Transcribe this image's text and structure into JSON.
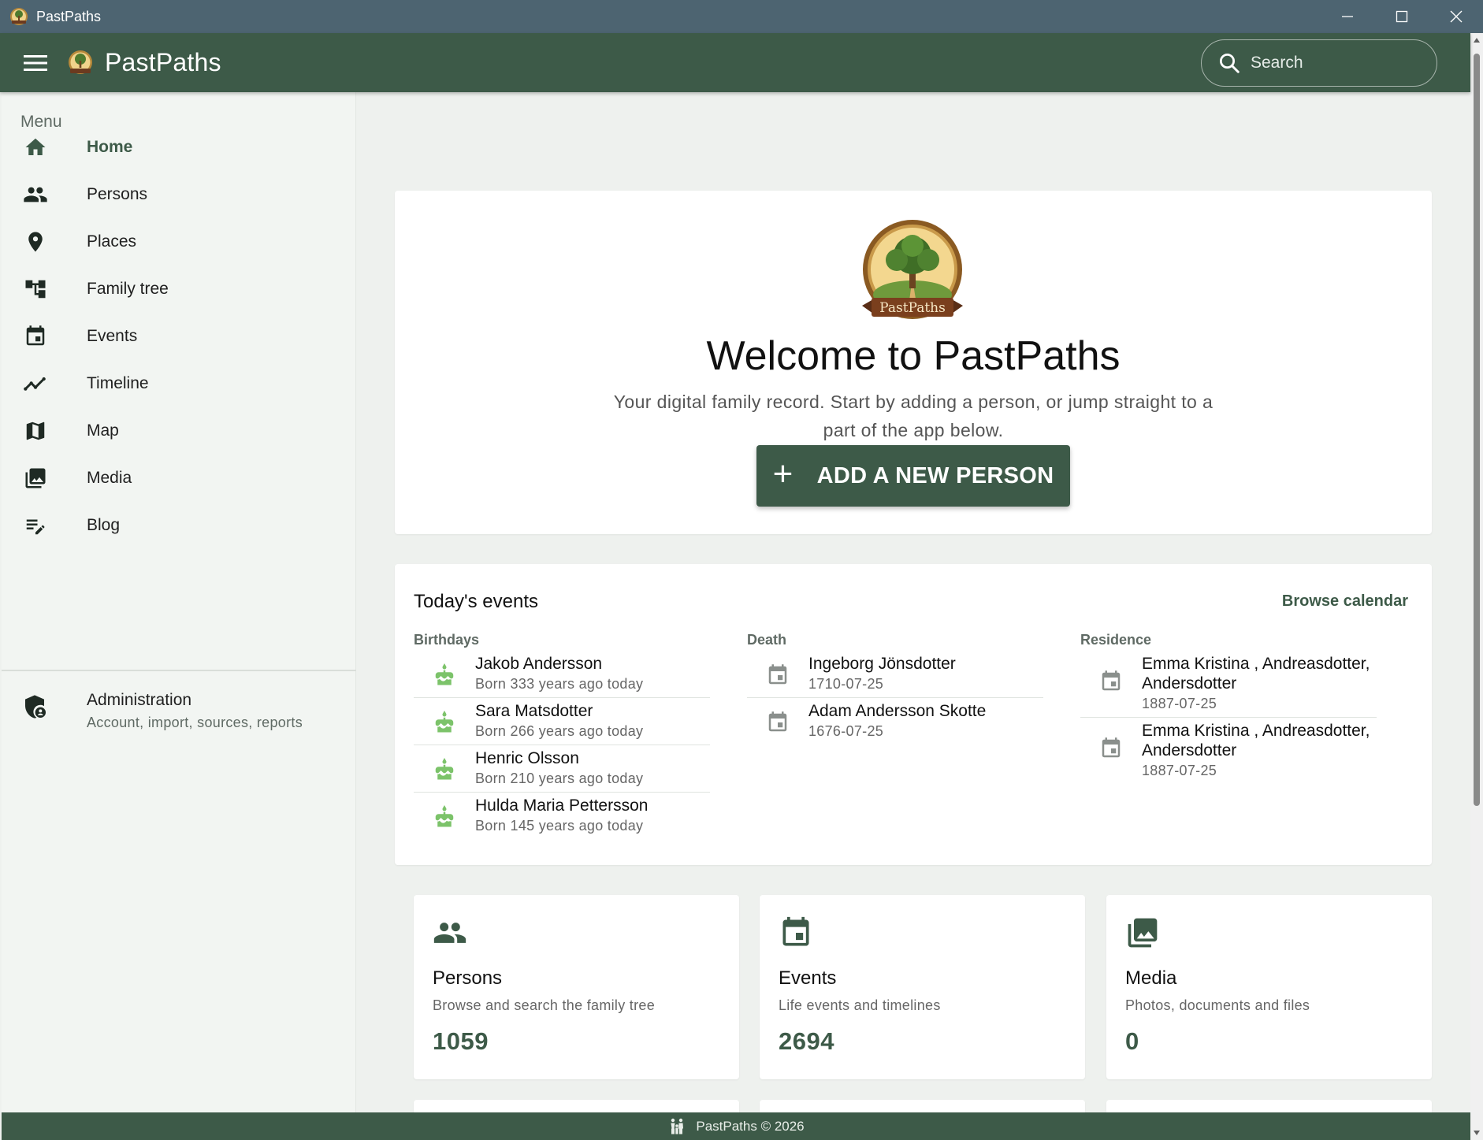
{
  "window": {
    "title": "PastPaths"
  },
  "appbar": {
    "brand": "PastPaths",
    "search_placeholder": "Search"
  },
  "sidebar": {
    "menu_label": "Menu",
    "items": [
      {
        "label": "Home",
        "icon": "home-icon"
      },
      {
        "label": "Persons",
        "icon": "people-icon"
      },
      {
        "label": "Places",
        "icon": "map-pin-icon"
      },
      {
        "label": "Family tree",
        "icon": "family-tree-icon"
      },
      {
        "label": "Events",
        "icon": "calendar-icon"
      },
      {
        "label": "Timeline",
        "icon": "timeline-icon"
      },
      {
        "label": "Map",
        "icon": "map-icon"
      },
      {
        "label": "Media",
        "icon": "photo-library-icon"
      },
      {
        "label": "Blog",
        "icon": "edit-note-icon"
      }
    ],
    "admin": {
      "title": "Administration",
      "subtitle": "Account, import, sources, reports",
      "icon": "admin-shield-icon"
    }
  },
  "welcome": {
    "logo_text": "PastPaths",
    "heading": "Welcome to PastPaths",
    "lead": "Your digital family record. Start by adding a person, or jump straight to a part of the app below.",
    "cta_label": "ADD A NEW PERSON"
  },
  "today": {
    "title": "Today's events",
    "browse_label": "Browse calendar",
    "birthdays": {
      "heading": "Birthdays",
      "items": [
        {
          "name": "Jakob Andersson",
          "sub": "Born 333 years ago today"
        },
        {
          "name": "Sara Matsdotter",
          "sub": "Born 266 years ago today"
        },
        {
          "name": "Henric Olsson",
          "sub": "Born 210 years ago today"
        },
        {
          "name": "Hulda Maria Pettersson",
          "sub": "Born 145 years ago today"
        }
      ]
    },
    "death": {
      "heading": "Death",
      "items": [
        {
          "name": "Ingeborg Jönsdotter",
          "sub": "1710-07-25"
        },
        {
          "name": "Adam Andersson Skotte",
          "sub": "1676-07-25"
        }
      ]
    },
    "residence": {
      "heading": "Residence",
      "items": [
        {
          "name": "Emma Kristina , Andreasdotter, Andersdotter",
          "sub": "1887-07-25"
        },
        {
          "name": "Emma Kristina , Andreasdotter, Andersdotter",
          "sub": "1887-07-25"
        }
      ]
    }
  },
  "stats": [
    {
      "title": "Persons",
      "desc": "Browse and search the family tree",
      "count": "1059",
      "icon": "people-icon"
    },
    {
      "title": "Events",
      "desc": "Life events and timelines",
      "count": "2694",
      "icon": "calendar-icon"
    },
    {
      "title": "Media",
      "desc": "Photos, documents and files",
      "count": "0",
      "icon": "photo-library-icon"
    }
  ],
  "footer": {
    "text": "PastPaths © 2026"
  },
  "colors": {
    "primary": "#3d5a48",
    "titlebar": "#4d6471",
    "background": "#eef1ee",
    "birthday_icon": "#7cc36a"
  }
}
